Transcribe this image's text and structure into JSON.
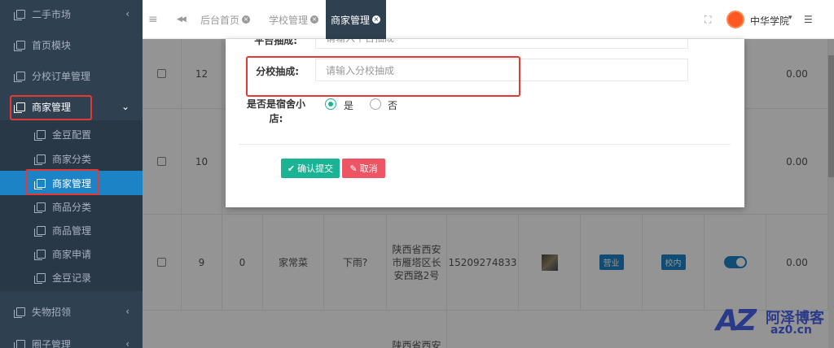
{
  "sidebar": {
    "items": [
      {
        "label": "二手市场",
        "arrow": "‹"
      },
      {
        "label": "首页模块"
      },
      {
        "label": "分校订单管理"
      },
      {
        "label": "商家管理",
        "arrow": "⌄"
      },
      {
        "label": "金豆配置"
      },
      {
        "label": "商家分类"
      },
      {
        "label": "商家管理"
      },
      {
        "label": "商品分类"
      },
      {
        "label": "商品管理"
      },
      {
        "label": "商家申请"
      },
      {
        "label": "金豆记录"
      },
      {
        "label": "失物招领",
        "arrow": "‹"
      },
      {
        "label": "圈子管理",
        "arrow": "‹"
      }
    ]
  },
  "topbar": {
    "menu_icon": "≡",
    "back_icon": "◀◀",
    "tabs": [
      {
        "label": "后台首页"
      },
      {
        "label": "学校管理"
      },
      {
        "label": "商家管理"
      }
    ],
    "fullscreen_icon": "⛶",
    "user_name": "中华学院",
    "caret": "▾",
    "settings_icon": "☰",
    "close_glyph": "×"
  },
  "table": {
    "rows": [
      {
        "id": "12",
        "amount": "0.00"
      },
      {
        "id": "10",
        "amount": "0.00"
      },
      {
        "id": "9",
        "sort": "0",
        "category": "家常菜",
        "name": "下雨?",
        "address": "陕西省西安市雁塔区长安西路2号",
        "phone": "15209274833",
        "status": "营业",
        "type": "校内",
        "amount": "0.00"
      },
      {
        "address": "陕西省西安"
      }
    ]
  },
  "modal": {
    "top_label": "平台抽成:",
    "top_placeholder": "请输入平台抽成",
    "school_cut_label": "分校抽成:",
    "school_cut_placeholder": "请输入分校抽成",
    "dorm_label": "是否是宿舍小店:",
    "dorm_options": [
      "是",
      "否"
    ],
    "dorm_selected": "是",
    "submit_label": "确认提交",
    "cancel_label": "取消",
    "submit_icon": "✔",
    "cancel_icon": "✎"
  },
  "watermark": {
    "logo": "AZ",
    "title": "阿泽博客",
    "url": "az0.cn"
  },
  "colors": {
    "sidebar_bg": "#2f4050",
    "active_blue": "#1c84c6",
    "green": "#1ab394",
    "red": "#ed5565",
    "highlight_red": "#e53935"
  }
}
